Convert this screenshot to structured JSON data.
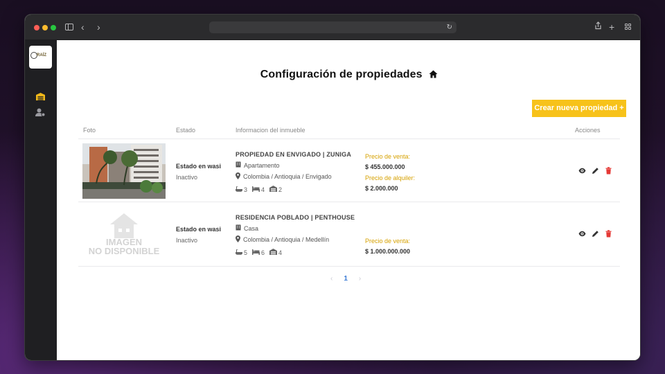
{
  "browser": {
    "url": ""
  },
  "page": {
    "title": "Configuración de propiedades",
    "create_label": "Crear nueva propiedad +"
  },
  "table": {
    "headers": {
      "foto": "Foto",
      "estado": "Estado",
      "info": "Informacion del inmueble",
      "acciones": "Acciones"
    },
    "rows": [
      {
        "estado_label": "Estado en wasi",
        "estado_value": "Inactivo",
        "title": "PROPIEDAD EN ENVIGADO | ZUNIGA",
        "type": "Apartamento",
        "location": "Colombia / Antioquia / Envigado",
        "baths": "3",
        "beds": "4",
        "garages": "2",
        "sale_label": "Precio de venta:",
        "sale_value": "$ 455.000.000",
        "rent_label": "Precio de alquiler:",
        "rent_value": "$ 2.000.000"
      },
      {
        "estado_label": "Estado en wasi",
        "estado_value": "Inactivo",
        "title": "RESIDENCIA POBLADO | PENTHOUSE",
        "type": "Casa",
        "location": "Colombia / Antioquia / Medellín",
        "baths": "5",
        "beds": "6",
        "garages": "4",
        "sale_label": "Precio de venta:",
        "sale_value": "$ 1.000.000.000",
        "placeholder_line1": "IMAGEN",
        "placeholder_line2": "NO DISPONIBLE"
      }
    ]
  },
  "pagination": {
    "prev": "‹",
    "current": "1",
    "next": "›"
  },
  "colors": {
    "accent": "#f7c21a",
    "danger": "#e53935",
    "sidebar": "#1f1f22"
  }
}
